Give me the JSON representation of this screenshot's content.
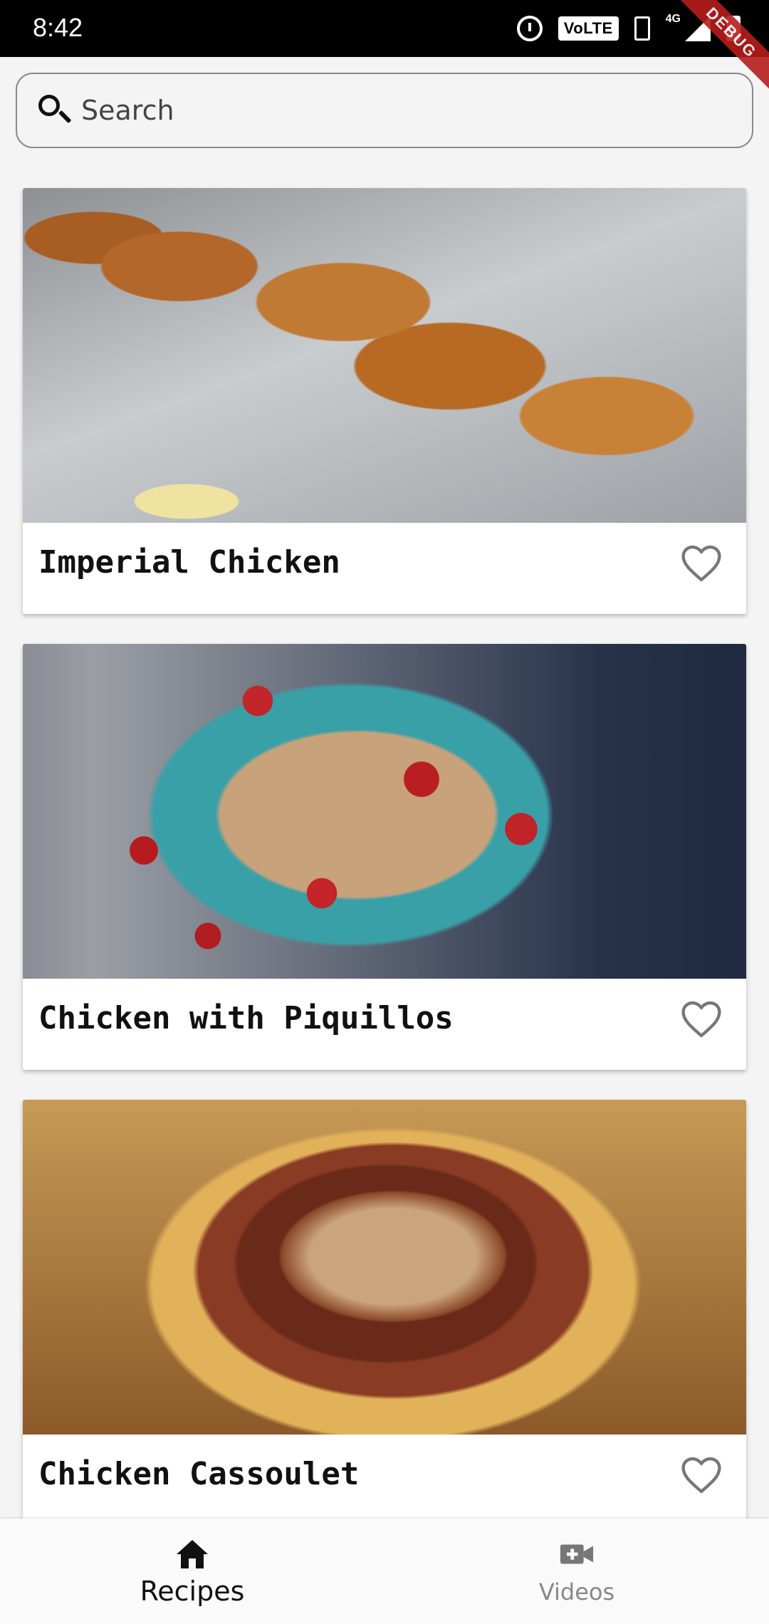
{
  "status_bar": {
    "time": "8:42",
    "volte": "VoLTE",
    "network": "4G",
    "debug_banner": "DEBUG"
  },
  "search": {
    "placeholder": "Search",
    "icon": "search-icon"
  },
  "recipes": [
    {
      "title": "Imperial Chicken",
      "favorite_icon": "heart-outline-icon"
    },
    {
      "title": "Chicken with Piquillos",
      "favorite_icon": "heart-outline-icon"
    },
    {
      "title": "Chicken Cassoulet",
      "favorite_icon": "heart-outline-icon"
    }
  ],
  "bottom_nav": {
    "items": [
      {
        "label": "Recipes",
        "icon": "home-icon",
        "active": true
      },
      {
        "label": "Videos",
        "icon": "video-add-icon",
        "active": false
      }
    ]
  },
  "colors": {
    "background": "#f4f4f4",
    "active_nav": "#111111",
    "inactive_nav": "#888888",
    "debug_banner": "#b71c1c"
  }
}
